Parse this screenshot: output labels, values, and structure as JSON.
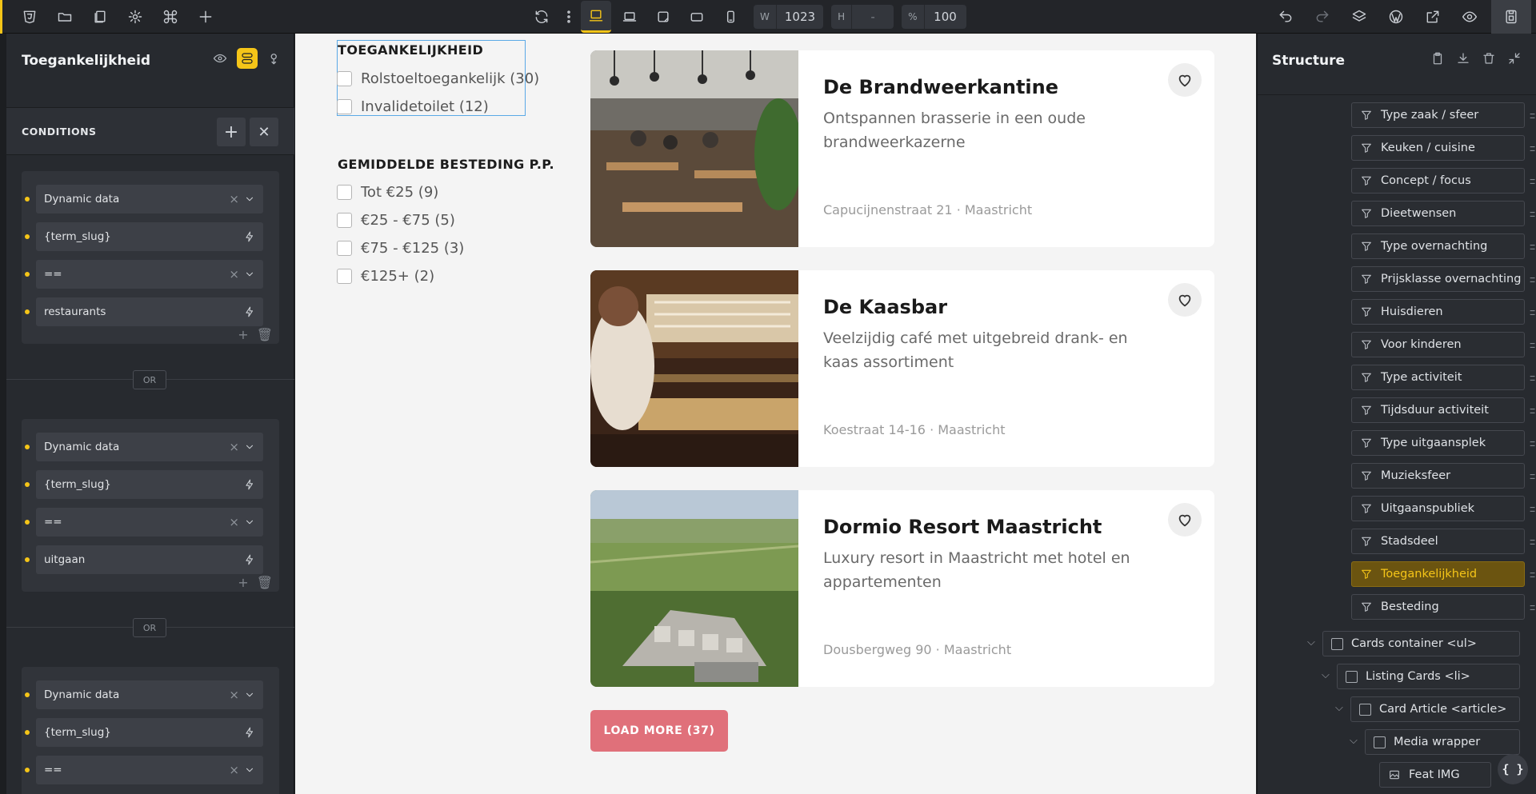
{
  "toolbar": {
    "width_label": "W",
    "width_value": "1023",
    "height_label": "H",
    "height_value": "-",
    "zoom_label": "%",
    "zoom_value": "100"
  },
  "left_panel": {
    "title": "Toegankelijkheid",
    "conditions_title": "CONDITIONS",
    "or_label": "OR",
    "groups": [
      {
        "rows": [
          "Dynamic data",
          "{term_slug}",
          "==",
          "restaurants"
        ]
      },
      {
        "rows": [
          "Dynamic data",
          "{term_slug}",
          "==",
          "uitgaan"
        ]
      },
      {
        "rows": [
          "Dynamic data",
          "{term_slug}",
          "=="
        ]
      }
    ]
  },
  "canvas": {
    "filter1": {
      "title": "TOEGANKELIJKHEID",
      "options": [
        "Rolstoeltoegankelijk (30)",
        "Invalidetoilet (12)"
      ]
    },
    "filter2": {
      "title": "GEMIDDELDE BESTEDING P.P.",
      "options": [
        "Tot €25 (9)",
        "€25 - €75 (5)",
        "€75 - €125 (3)",
        "€125+ (2)"
      ]
    },
    "cards": [
      {
        "name": "De Brandweerkantine",
        "desc": "Ontspannen brasserie in een oude brandweerkazerne",
        "addr": "Capucijnenstraat 21 · Maastricht"
      },
      {
        "name": "De Kaasbar",
        "desc": "Veelzijdig café met uitgebreid drank- en kaas assortiment",
        "addr": "Koestraat 14-16 · Maastricht"
      },
      {
        "name": "Dormio Resort Maastricht",
        "desc": "Luxury resort in Maastricht met hotel en appartementen",
        "addr": "Dousbergweg 90 · Maastricht"
      }
    ],
    "load_more": "LOAD MORE (37)"
  },
  "right_panel": {
    "title": "Structure",
    "filters": [
      "Type zaak / sfeer",
      "Keuken / cuisine",
      "Concept / focus",
      "Dieetwensen",
      "Type overnachting",
      "Prijsklasse overnachting",
      "Huisdieren",
      "Voor kinderen",
      "Type activiteit",
      "Tijdsduur activiteit",
      "Type uitgaansplek",
      "Muzieksfeer",
      "Uitgaanspubliek",
      "Stadsdeel",
      "Toegankelijkheid",
      "Besteding"
    ],
    "selected": "Toegankelijkheid",
    "tree": [
      "Cards container <ul>",
      "Listing Cards <li>",
      "Card Article <article>",
      "Media wrapper",
      "Feat IMG"
    ]
  },
  "colors": {
    "accent": "#f5c518",
    "load_more": "#e0707a",
    "selection": "#6b5410"
  }
}
